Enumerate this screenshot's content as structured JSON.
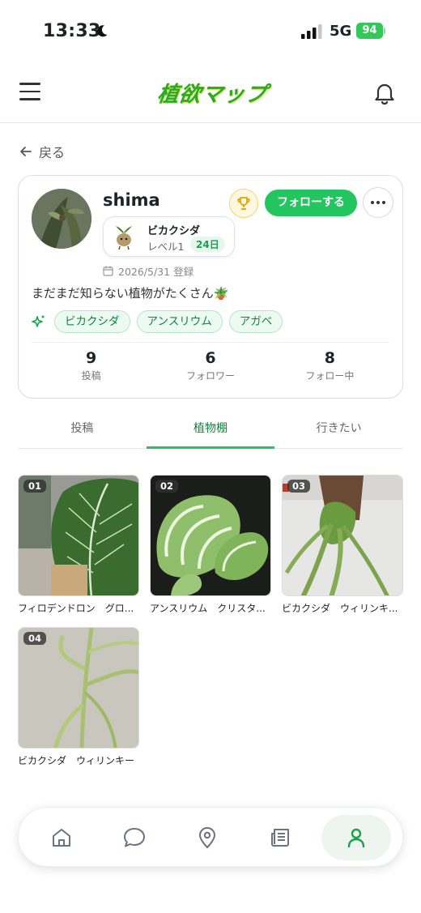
{
  "status_bar": {
    "time": "13:33",
    "network": "5G",
    "battery": "94"
  },
  "header": {
    "logo_text": "植欲マップ",
    "icons": [
      "menu-icon",
      "bell-icon"
    ]
  },
  "back_label": "戻る",
  "profile": {
    "username": "shima",
    "follow_label": "フォローする",
    "level_title": "ビカクシダ",
    "level_label": "レベル1",
    "level_days": "24日",
    "joined": "2026/5/31 登録",
    "bio": "まだまだ知らない植物がたくさん🪴",
    "tags": [
      "ビカクシダ",
      "アンスリウム",
      "アガベ"
    ],
    "stats": [
      {
        "value": "9",
        "label": "投稿"
      },
      {
        "value": "6",
        "label": "フォロワー"
      },
      {
        "value": "8",
        "label": "フォロー中"
      }
    ]
  },
  "tabs": [
    {
      "label": "投稿",
      "active": false
    },
    {
      "label": "植物棚",
      "active": true
    },
    {
      "label": "行きたい",
      "active": false
    }
  ],
  "plants": [
    {
      "num": "01",
      "caption": "フィロデンドロン　グロ..."
    },
    {
      "num": "02",
      "caption": "アンスリウム　クリスタ..."
    },
    {
      "num": "03",
      "caption": "ビカクシダ　ウィリンキ..."
    },
    {
      "num": "04",
      "caption": "ビカクシダ　ウィリンキー"
    }
  ],
  "bottom_nav": [
    "home-icon",
    "chat-icon",
    "map-pin-icon",
    "news-icon",
    "profile-icon"
  ],
  "colors": {
    "accent": "#22c55e",
    "accent_dark": "#15803d",
    "tag_bg": "#ecfbf1"
  }
}
